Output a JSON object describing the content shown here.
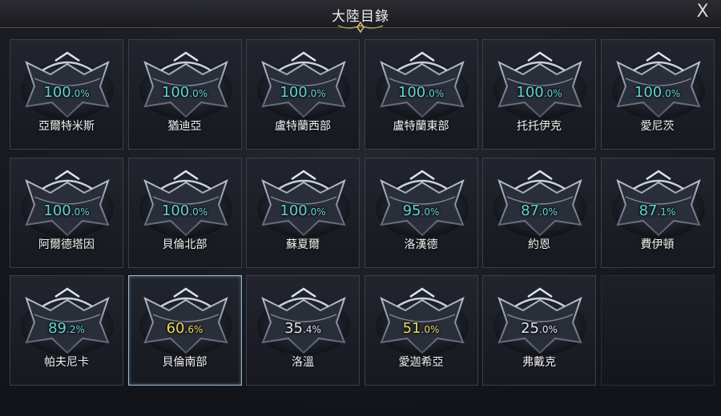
{
  "header": {
    "title": "大陸目錄",
    "close_label": "X"
  },
  "tiles": [
    {
      "name": "亞爾特米斯",
      "pct_int": "100",
      "pct_dec": ".0%",
      "color": "cyan"
    },
    {
      "name": "猶迪亞",
      "pct_int": "100",
      "pct_dec": ".0%",
      "color": "cyan"
    },
    {
      "name": "盧特蘭西部",
      "pct_int": "100",
      "pct_dec": ".0%",
      "color": "cyan"
    },
    {
      "name": "盧特蘭東部",
      "pct_int": "100",
      "pct_dec": ".0%",
      "color": "cyan"
    },
    {
      "name": "托托伊克",
      "pct_int": "100",
      "pct_dec": ".0%",
      "color": "cyan"
    },
    {
      "name": "愛尼茨",
      "pct_int": "100",
      "pct_dec": ".0%",
      "color": "cyan"
    },
    {
      "name": "阿爾德塔因",
      "pct_int": "100",
      "pct_dec": ".0%",
      "color": "cyan"
    },
    {
      "name": "貝倫北部",
      "pct_int": "100",
      "pct_dec": ".0%",
      "color": "cyan"
    },
    {
      "name": "蘇夏爾",
      "pct_int": "100",
      "pct_dec": ".0%",
      "color": "cyan"
    },
    {
      "name": "洛漢德",
      "pct_int": "95",
      "pct_dec": ".0%",
      "color": "cyan"
    },
    {
      "name": "約恩",
      "pct_int": "87",
      "pct_dec": ".0%",
      "color": "cyan"
    },
    {
      "name": "費伊頓",
      "pct_int": "87",
      "pct_dec": ".1%",
      "color": "cyan"
    },
    {
      "name": "帕夫尼卡",
      "pct_int": "89",
      "pct_dec": ".2%",
      "color": "cyan"
    },
    {
      "name": "貝倫南部",
      "pct_int": "60",
      "pct_dec": ".6%",
      "color": "yellow",
      "selected": true
    },
    {
      "name": "洛溫",
      "pct_int": "35",
      "pct_dec": ".4%",
      "color": "white"
    },
    {
      "name": "愛迦希亞",
      "pct_int": "51",
      "pct_dec": ".0%",
      "color": "yellow"
    },
    {
      "name": "弗戴克",
      "pct_int": "25",
      "pct_dec": ".0%",
      "color": "white"
    }
  ],
  "colors": {
    "cyan": "#5fd4d1",
    "yellow": "#e9d95a",
    "white": "#dfe7ea",
    "selected_border": "#9db6cc"
  }
}
